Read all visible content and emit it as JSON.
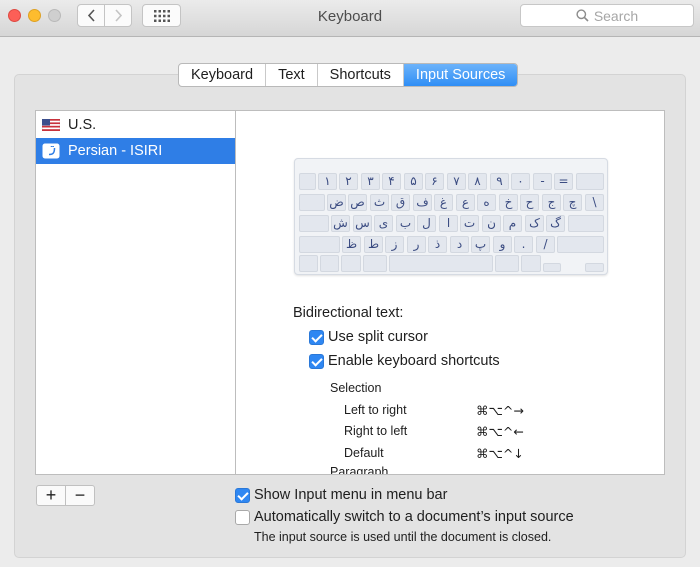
{
  "window": {
    "title": "Keyboard"
  },
  "toolbar": {
    "search_placeholder": "Search"
  },
  "tabs": [
    {
      "label": "Keyboard",
      "active": false
    },
    {
      "label": "Text",
      "active": false
    },
    {
      "label": "Shortcuts",
      "active": false
    },
    {
      "label": "Input Sources",
      "active": true
    }
  ],
  "sources": [
    {
      "label": "U.S.",
      "selected": false,
      "icon": "us-flag-icon"
    },
    {
      "label": "Persian - ISIRI",
      "selected": true,
      "icon": "persian-input-icon"
    }
  ],
  "keyboard": {
    "rows": [
      [
        "",
        "۱",
        "۲",
        "۳",
        "۴",
        "۵",
        "۶",
        "۷",
        "۸",
        "۹",
        "۰",
        "-",
        "=",
        ""
      ],
      [
        "",
        "ض",
        "ص",
        "ث",
        "ق",
        "ف",
        "غ",
        "ع",
        "ه",
        "خ",
        "ح",
        "ج",
        "چ",
        "\\"
      ],
      [
        "",
        "ش",
        "س",
        "ی",
        "ب",
        "ل",
        "ا",
        "ت",
        "ن",
        "م",
        "ک",
        "گ",
        ""
      ],
      [
        "",
        "ظ",
        "ط",
        "ز",
        "ر",
        "ذ",
        "د",
        "پ",
        "و",
        ".",
        "/",
        ""
      ],
      [
        "",
        "",
        "",
        "",
        "",
        "",
        "",
        "",
        ""
      ]
    ]
  },
  "bidi": {
    "heading": "Bidirectional text:",
    "use_split_cursor": {
      "label": "Use split cursor",
      "checked": true
    },
    "enable_shortcuts": {
      "label": "Enable keyboard shortcuts",
      "checked": true
    },
    "selection_label": "Selection",
    "selection_items": [
      {
        "label": "Left to right",
        "shortcut": "⌘⌥^→"
      },
      {
        "label": "Right to left",
        "shortcut": "⌘⌥^←"
      },
      {
        "label": "Default",
        "shortcut": "⌘⌥^↓"
      }
    ],
    "paragraph_label": "Paragraph"
  },
  "list_controls": {
    "add": "+",
    "remove": "−"
  },
  "options": {
    "show_input_menu": {
      "label": "Show Input menu in menu bar",
      "checked": true
    },
    "auto_switch": {
      "label": "Automatically switch to a document’s input source",
      "checked": false
    },
    "note": "The input source is used until the document is closed."
  },
  "colors": {
    "accent": "#2f87f2",
    "selection": "#2f7ee6",
    "key_text": "#3b4c82"
  }
}
